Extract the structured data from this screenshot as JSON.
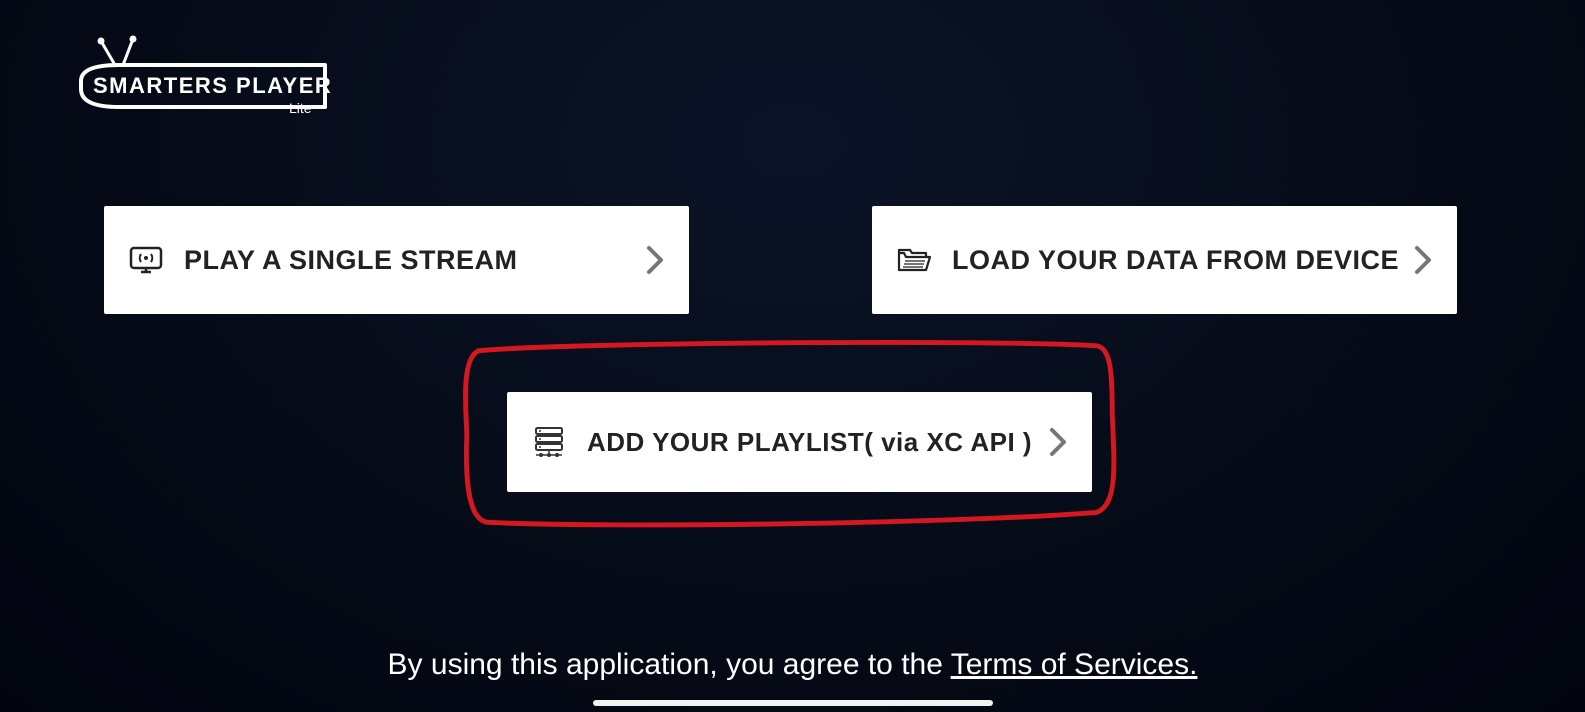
{
  "logo": {
    "line1": "SMARTERS PLAYER",
    "line2": "Lite"
  },
  "options": {
    "play_single_stream": "PLAY A SINGLE STREAM",
    "load_from_device": "LOAD YOUR DATA FROM DEVICE",
    "add_playlist_xc": "ADD YOUR PLAYLIST( via XC API )"
  },
  "footer": {
    "agree_text": "By using this application, you agree to the ",
    "tos_label": "Terms of Services."
  }
}
